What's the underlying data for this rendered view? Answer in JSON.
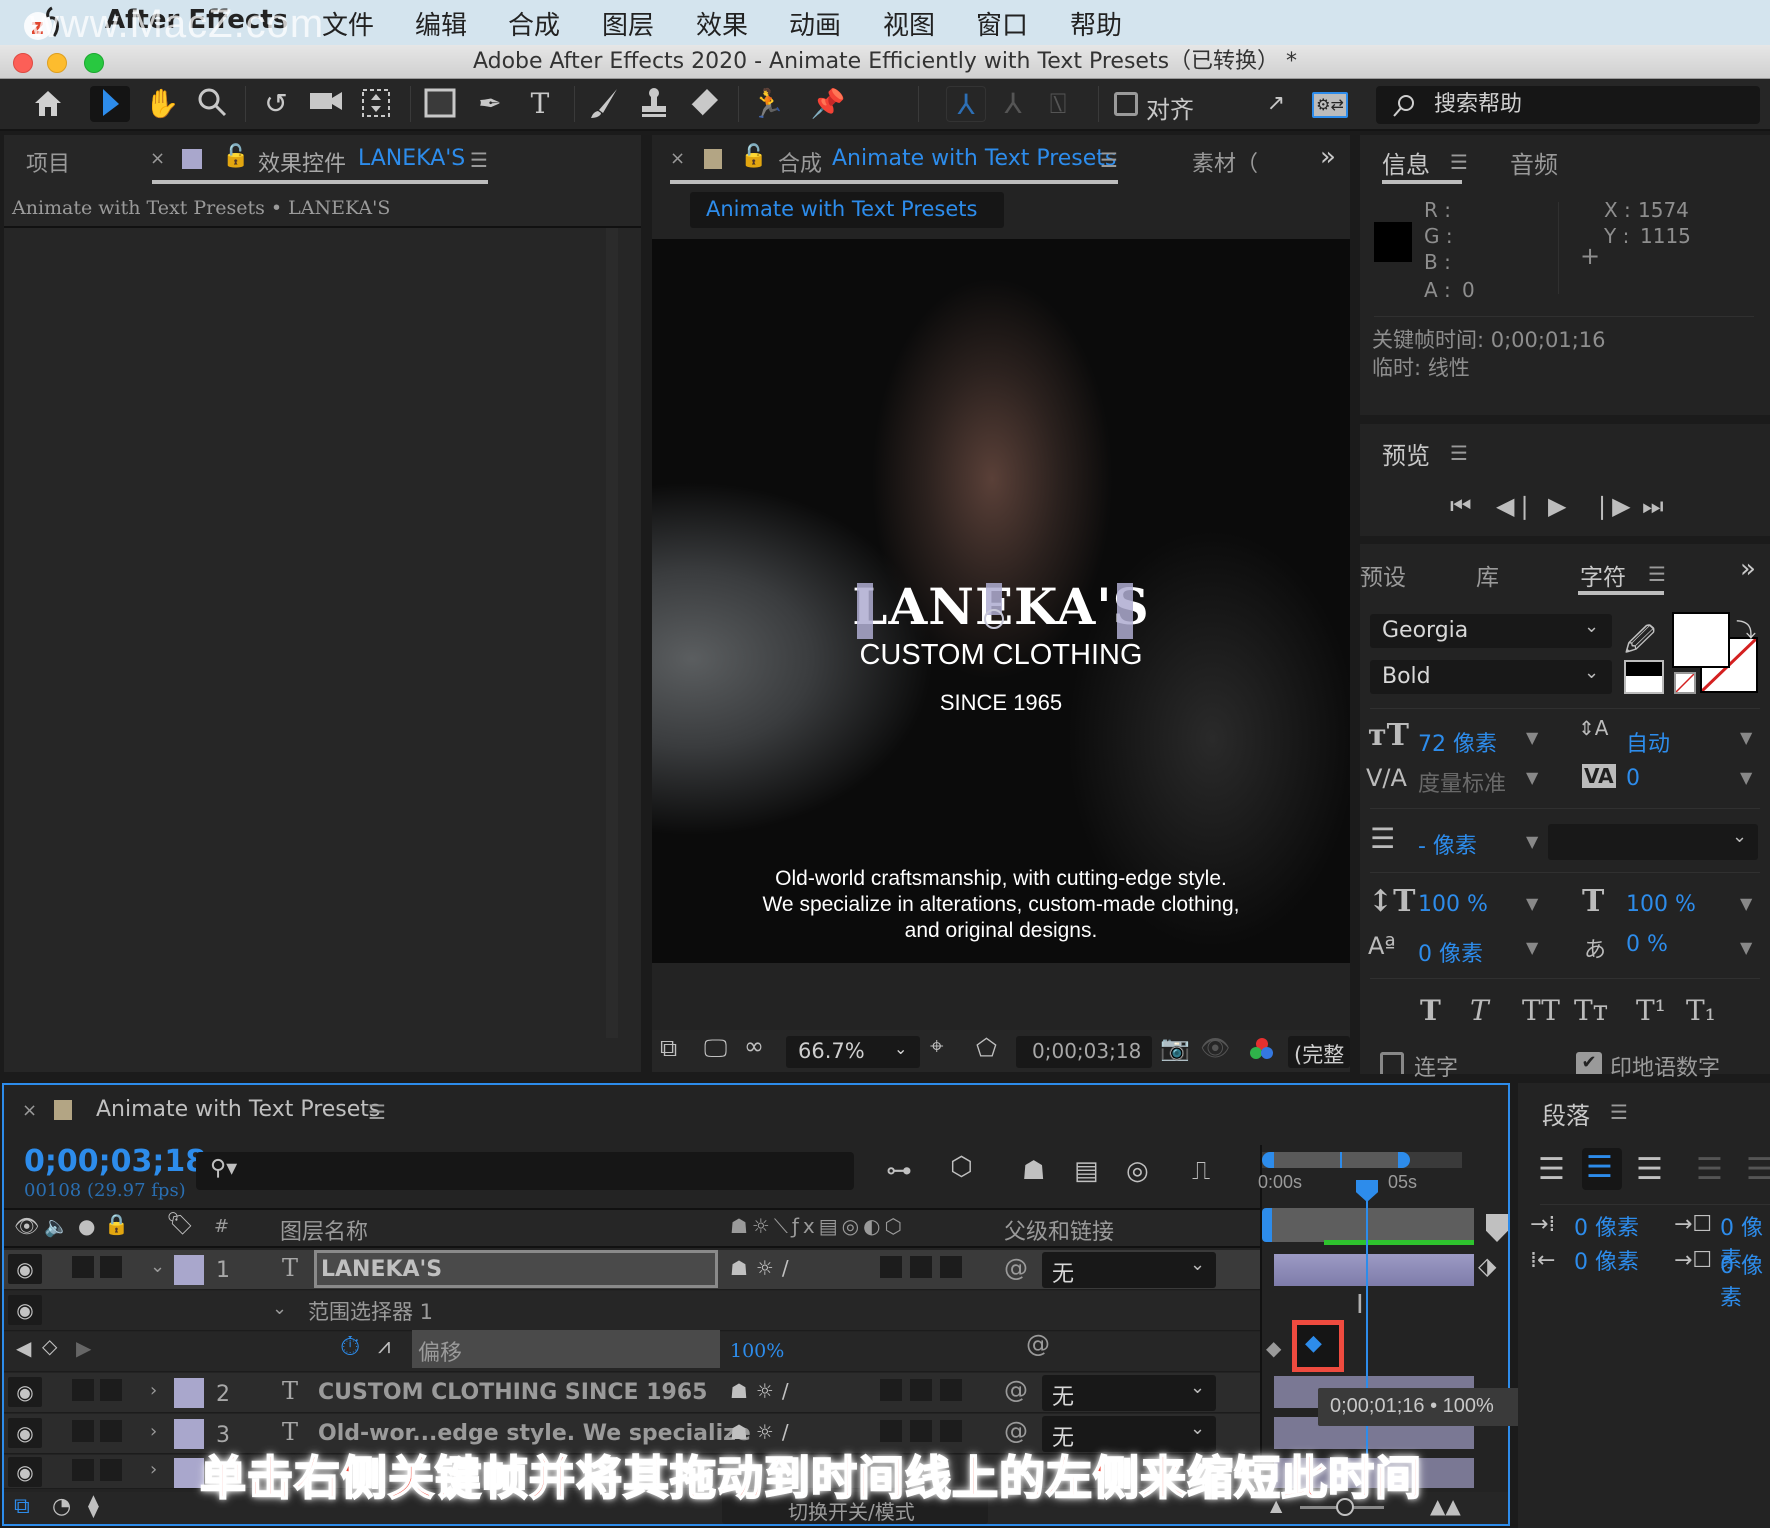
{
  "menubar": {
    "watermark": "www.MacZ.com",
    "app_name": "After Effects",
    "items": [
      "文件",
      "编辑",
      "合成",
      "图层",
      "效果",
      "动画",
      "视图",
      "窗口",
      "帮助"
    ]
  },
  "window": {
    "title": "Adobe After Effects 2020 - Animate Efficiently with Text Presets（已转换） *"
  },
  "toolbar": {
    "tools": [
      "home",
      "selection",
      "hand",
      "zoom",
      "rotate",
      "camera",
      "pan-behind",
      "rectangle",
      "pen",
      "type",
      "brush",
      "clone-stamp",
      "eraser",
      "roto-brush",
      "puppet-pin"
    ],
    "snapping_label": "对齐",
    "search_placeholder": "搜索帮助"
  },
  "left_panel": {
    "tab_project": "项目",
    "tab_effects": "效果控件",
    "tab_effects_layer": "LANEKA'S",
    "breadcrumb": "Animate with Text Presets • LANEKA'S"
  },
  "comp_panel": {
    "tab_prefix": "合成",
    "tab_name": "Animate with Text Presets",
    "tab_footage": "素材（",
    "overflow": "»",
    "sub_tab": "Animate with Text Presets",
    "viewer": {
      "title": "LANEKA'S",
      "subtitle": "CUSTOM CLOTHING",
      "since": "SINCE 1965",
      "body_lines": [
        "Old-world craftsmanship, with cutting-edge style.",
        "We specialize in alterations, custom-made clothing,",
        "and original designs."
      ]
    },
    "footer": {
      "zoom": "66.7%",
      "timecode": "0;00;03;18",
      "resolution": "(完整"
    }
  },
  "info_panel": {
    "tab_info": "信息",
    "tab_audio": "音频",
    "r_label": "R :",
    "g_label": "G :",
    "b_label": "B :",
    "a_label": "A :",
    "a_value": "0",
    "x_label": "X :",
    "x_value": "1574",
    "y_label": "Y :",
    "y_value": "1115",
    "keyframe_time": "关键帧时间: 0;00;01;16",
    "temporal": "临时: 线性",
    "swatch_color": "#000000"
  },
  "preview_panel": {
    "title": "预览",
    "controls": [
      "first-frame",
      "prev-frame",
      "play",
      "next-frame",
      "last-frame"
    ]
  },
  "character_panel": {
    "tab_presets": "预设",
    "tab_library": "库",
    "tab_character": "字符",
    "font_family": "Georgia",
    "font_style": "Bold",
    "font_size": "72 像素",
    "leading": "自动",
    "kerning": "度量标准",
    "tracking": "0",
    "stroke_width": "- 像素",
    "vertical_scale": "100 %",
    "horizontal_scale": "100 %",
    "baseline_shift": "0 像素",
    "tsume": "0 %",
    "style_buttons": [
      "T",
      "T",
      "TT",
      "Tт",
      "T¹",
      "T₁"
    ],
    "ligatures_label": "连字",
    "ligatures_checked": false,
    "hindi_digits_label": "印地语数字",
    "hindi_digits_checked": true,
    "fill_color": "#ffffff",
    "stroke_color": "none"
  },
  "paragraph_panel": {
    "title": "段落",
    "indent_left": "0 像素",
    "indent_right": "0 像素",
    "space_before": "0 像素",
    "space_after": "0 像素",
    "alignment_selected": "center"
  },
  "timeline": {
    "tab_name": "Animate with Text Presets",
    "current_time": "0;00;03;18",
    "frame_info": "00108 (29.97 fps)",
    "search_placeholder": "",
    "col_layer_name": "图层名称",
    "col_number": "#",
    "col_parent": "父级和链接",
    "ruler_start": "0:00s",
    "ruler_mark": "05s",
    "toggle_label": "切换开关/模式",
    "layers": [
      {
        "num": "1",
        "type": "T",
        "name": "LANEKA'S",
        "parent": "无",
        "expanded": true
      },
      {
        "num": "2",
        "type": "T",
        "name": "CUSTOM CLOTHING  SINCE 1965",
        "parent": "无",
        "expanded": false
      },
      {
        "num": "3",
        "type": "T",
        "name": "Old-wor...edge style. We specialize",
        "parent": "无",
        "expanded": false
      }
    ],
    "range_selector": "范围选择器 1",
    "property_name": "偏移",
    "property_value": "100%",
    "keyframe_tooltip": "0;00;01;16 • 100%"
  },
  "caption": "单击右侧关键帧并将其拖动到时间线上的左侧来缩短此时间"
}
